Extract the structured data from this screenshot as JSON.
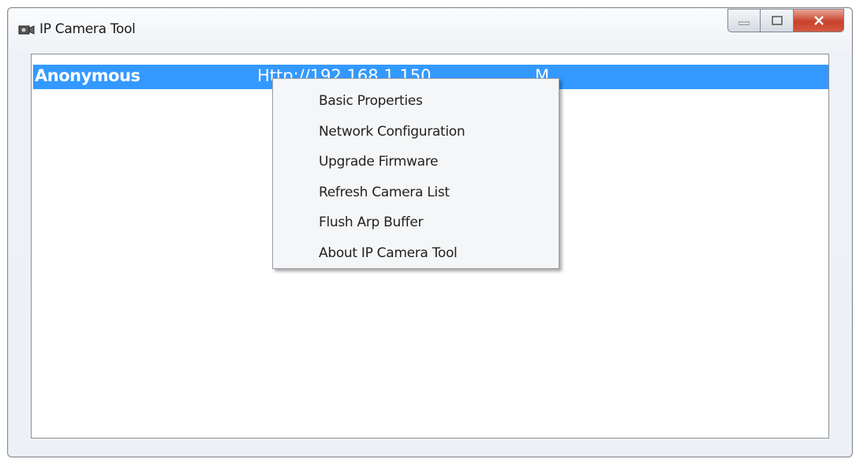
{
  "window": {
    "title": "IP Camera Tool"
  },
  "camera_list": {
    "rows": [
      {
        "name": "Anonymous",
        "url": "Http://192.168.1.150",
        "extra": "M"
      }
    ]
  },
  "context_menu": {
    "items": [
      "Basic Properties",
      "Network Configuration",
      "Upgrade Firmware",
      "Refresh Camera List",
      "Flush Arp Buffer",
      "About IP Camera Tool"
    ]
  },
  "colors": {
    "selection": "#3399ff",
    "close_button": "#c8422b"
  },
  "icons": {
    "app": "camera-icon",
    "minimize": "minimize-icon",
    "maximize": "maximize-icon",
    "close": "close-icon"
  }
}
